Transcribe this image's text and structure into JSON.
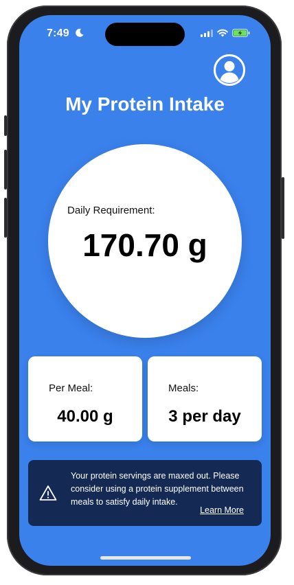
{
  "status_bar": {
    "time": "7:49"
  },
  "header": {
    "title": "My Protein Intake"
  },
  "daily": {
    "label": "Daily Requirement:",
    "value": "170.70 g"
  },
  "per_meal": {
    "label": "Per Meal:",
    "value": "40.00 g"
  },
  "meals": {
    "label": "Meals:",
    "value": "3 per day"
  },
  "alert": {
    "message": "Your protein servings are maxed out. Please consider using a protein supplement between meals to satisfy daily intake.",
    "link_label": "Learn More"
  },
  "colors": {
    "background": "#3a81ec",
    "alert_background": "#142a55",
    "card": "#ffffff"
  },
  "icons": [
    "moon-icon",
    "signal-icon",
    "wifi-icon",
    "battery-charging-icon",
    "profile-icon",
    "warning-icon"
  ]
}
